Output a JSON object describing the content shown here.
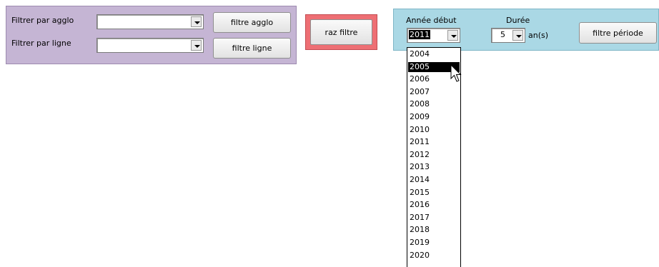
{
  "filters_panel": {
    "agglo_label": "Filtrer par agglo",
    "agglo_value": "",
    "agglo_button": "filtre agglo",
    "ligne_label": "Filtrer par ligne",
    "ligne_value": "",
    "ligne_button": "filtre ligne",
    "bg_color": "#c5b5d4"
  },
  "reset_panel": {
    "button_label": "raz filtre",
    "bg_color": "#ee6f74"
  },
  "period_panel": {
    "start_year_label": "Année début",
    "start_year_value": "2011",
    "duration_label": "Durée",
    "duration_value": "5",
    "duration_unit": "an(s)",
    "period_button": "filtre période",
    "bg_color": "#aad8e5"
  },
  "year_dropdown": {
    "hovered": "2005",
    "options": [
      "2004",
      "2005",
      "2006",
      "2007",
      "2008",
      "2009",
      "2010",
      "2011",
      "2012",
      "2013",
      "2014",
      "2015",
      "2016",
      "2017",
      "2018",
      "2019",
      "2020"
    ]
  },
  "icons": {
    "combo_arrow": "chevron-down-icon",
    "pointer": "mouse-pointer-icon"
  }
}
